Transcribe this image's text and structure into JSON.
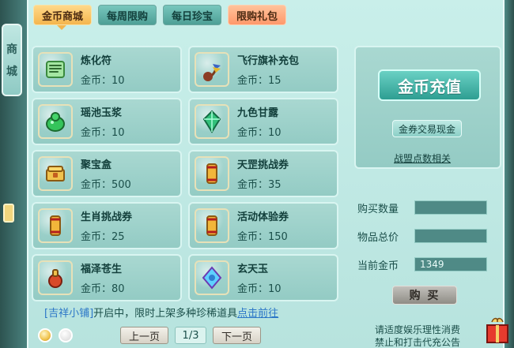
{
  "side": {
    "label_line1": "商",
    "label_line2": "城"
  },
  "tabs": [
    {
      "label": "金币商城",
      "active": true
    },
    {
      "label": "每周限购",
      "active": false
    },
    {
      "label": "每日珍宝",
      "active": false
    },
    {
      "label": "限购礼包",
      "active": false,
      "special": true
    }
  ],
  "items": [
    {
      "name": "炼化符",
      "price": "金币：10",
      "icon": "talisman-icon"
    },
    {
      "name": "飞行旗补充包",
      "price": "金币：15",
      "icon": "flag-pack-icon"
    },
    {
      "name": "瑶池玉浆",
      "price": "金币：10",
      "icon": "green-gourd-icon"
    },
    {
      "name": "九色甘露",
      "price": "金币：10",
      "icon": "green-crystal-icon"
    },
    {
      "name": "聚宝盒",
      "price": "金币：500",
      "icon": "treasure-box-icon"
    },
    {
      "name": "天罡挑战券",
      "price": "金币：35",
      "icon": "scroll-icon"
    },
    {
      "name": "生肖挑战券",
      "price": "金币：25",
      "icon": "scroll-icon"
    },
    {
      "name": "活动体验券",
      "price": "金币：150",
      "icon": "scroll-icon"
    },
    {
      "name": "福泽苍生",
      "price": "金币：80",
      "icon": "gourd-bottle-icon"
    },
    {
      "name": "玄天玉",
      "price": "金币：10",
      "icon": "blue-gem-icon"
    }
  ],
  "notice": {
    "bracket_text": "[吉祥小铺]",
    "middle_text": "开启中，限时上架多种珍稀道具",
    "link_text": "点击前往"
  },
  "pager": {
    "prev_label": "上一页",
    "page_text": "1/3",
    "next_label": "下一页"
  },
  "right_card": {
    "recharge_label": "金币充值",
    "trade_label": "金券交易现金",
    "alliance_link": "战盟点数相关"
  },
  "purchase": {
    "quantity_label": "购买数量",
    "total_label": "物品总价",
    "current_gold_label": "当前金币",
    "quantity_value": "",
    "total_value": "",
    "current_gold_value": "1349",
    "buy_label": "购 买"
  },
  "footer": {
    "line1": "请适度娱乐理性消费",
    "line2": "禁止和打击代充公告"
  },
  "colors": {
    "panel_bg": "#c9efea",
    "tab_active": "#f4b54d",
    "tab_special": "#ff986b",
    "recharge": "#2e9e92"
  }
}
